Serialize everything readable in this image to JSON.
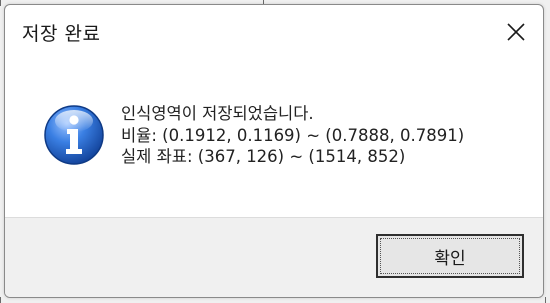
{
  "window": {
    "title": "저장 완료",
    "close_icon": "close-icon"
  },
  "message": {
    "icon": "info-icon",
    "line1": "인식영역이 저장되었습니다.",
    "line2": "비율: (0.1912, 0.1169) ~ (0.7888, 0.7891)",
    "line3": "실제 좌표: (367, 126) ~ (1514, 852)"
  },
  "buttons": {
    "ok_label": "확인"
  },
  "colors": {
    "info_icon_blue": "#1e5fc8",
    "footer_bg": "#f0f0f0",
    "button_border": "#2f2f2f"
  }
}
